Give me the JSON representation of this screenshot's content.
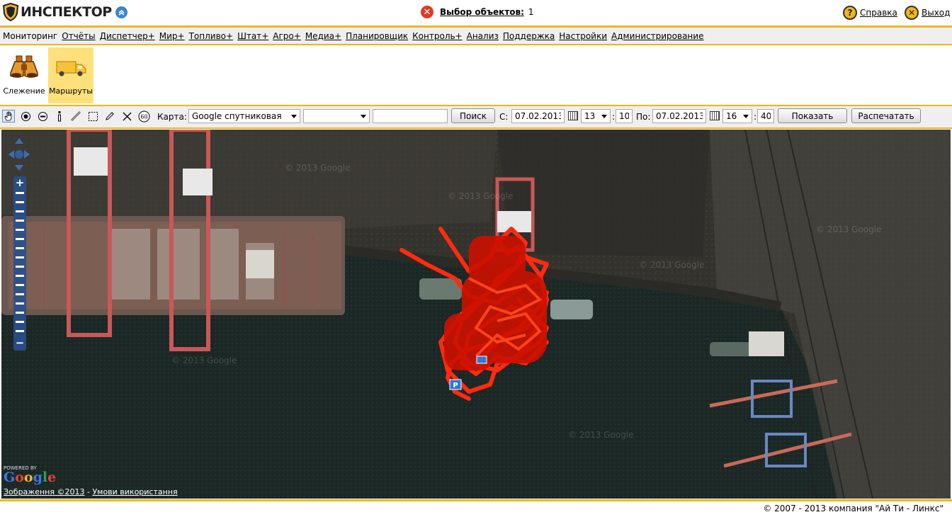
{
  "header": {
    "logo_text": "ИНСПЕКТОР",
    "object_selection_label": "Выбор объектов:",
    "object_selection_count": "1",
    "help_label": "Справка",
    "logout_label": "Выход"
  },
  "nav": {
    "items": [
      "Мониторинг",
      "Отчёты",
      "Диспетчер+",
      "Мир+",
      "Топливо+",
      "Штат+",
      "Агро+",
      "Медиа+",
      "Планировщик",
      "Контроль+",
      "Анализ",
      "Поддержка",
      "Настройки",
      "Администрирование"
    ]
  },
  "modules": {
    "tracking_label": "Слежение",
    "routes_label": "Маршруты"
  },
  "toolbar": {
    "zoom_level_badge": "60",
    "map_label": "Карта:",
    "map_type": "Google спутниковая",
    "object_select_value": "",
    "search_value": "",
    "search_button": "Поиск",
    "from_label": "С:",
    "from_date": "07.02.2013",
    "from_hour": "13",
    "from_minute": "10",
    "to_label": "По:",
    "to_date": "07.02.2013",
    "to_hour": "16",
    "to_minute": "40",
    "time_separator": ":",
    "show_button": "Показать",
    "print_button": "Распечатать"
  },
  "map": {
    "watermark": "© 2013 Google",
    "powered_by": "POWERED BY",
    "google_logo": "Google",
    "imagery_credit": "Зображення ©2013",
    "credit_separator": " - ",
    "terms_link": "Умови використання",
    "zoom_in": "+",
    "zoom_out": "−",
    "parking_marker": "P",
    "colors": {
      "track": "#ff2a10",
      "water": "#1e2a28",
      "pier": "#3a3a36",
      "accent": "#f0b427"
    }
  },
  "footer": {
    "copyright": "© 2007 - 2013 компания \"Ай Ти - Линкс\""
  }
}
